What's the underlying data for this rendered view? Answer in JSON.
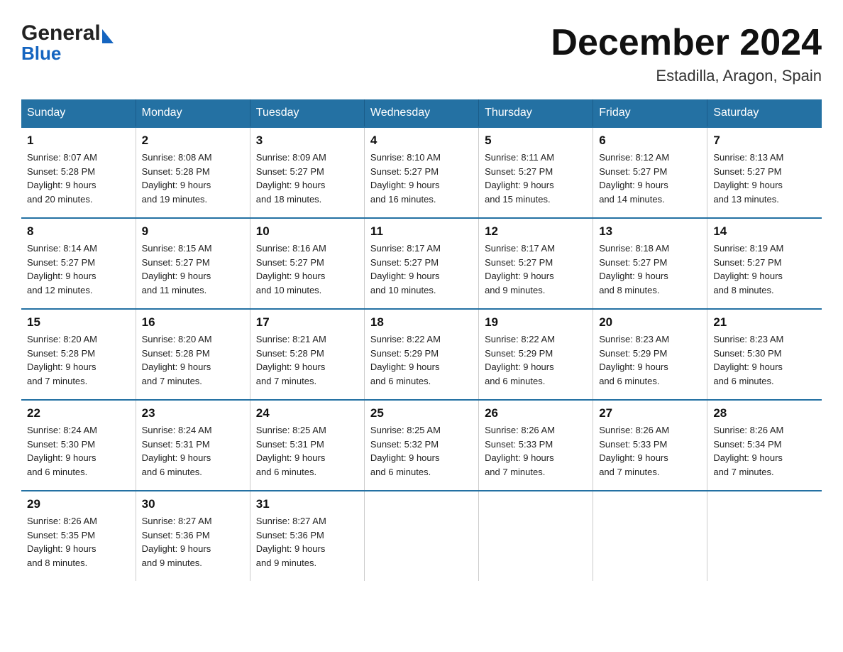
{
  "header": {
    "title": "December 2024",
    "subtitle": "Estadilla, Aragon, Spain",
    "logo_general": "General",
    "logo_blue": "Blue"
  },
  "columns": [
    "Sunday",
    "Monday",
    "Tuesday",
    "Wednesday",
    "Thursday",
    "Friday",
    "Saturday"
  ],
  "weeks": [
    [
      {
        "day": "1",
        "sunrise": "Sunrise: 8:07 AM",
        "sunset": "Sunset: 5:28 PM",
        "daylight": "Daylight: 9 hours",
        "daylight2": "and 20 minutes."
      },
      {
        "day": "2",
        "sunrise": "Sunrise: 8:08 AM",
        "sunset": "Sunset: 5:28 PM",
        "daylight": "Daylight: 9 hours",
        "daylight2": "and 19 minutes."
      },
      {
        "day": "3",
        "sunrise": "Sunrise: 8:09 AM",
        "sunset": "Sunset: 5:27 PM",
        "daylight": "Daylight: 9 hours",
        "daylight2": "and 18 minutes."
      },
      {
        "day": "4",
        "sunrise": "Sunrise: 8:10 AM",
        "sunset": "Sunset: 5:27 PM",
        "daylight": "Daylight: 9 hours",
        "daylight2": "and 16 minutes."
      },
      {
        "day": "5",
        "sunrise": "Sunrise: 8:11 AM",
        "sunset": "Sunset: 5:27 PM",
        "daylight": "Daylight: 9 hours",
        "daylight2": "and 15 minutes."
      },
      {
        "day": "6",
        "sunrise": "Sunrise: 8:12 AM",
        "sunset": "Sunset: 5:27 PM",
        "daylight": "Daylight: 9 hours",
        "daylight2": "and 14 minutes."
      },
      {
        "day": "7",
        "sunrise": "Sunrise: 8:13 AM",
        "sunset": "Sunset: 5:27 PM",
        "daylight": "Daylight: 9 hours",
        "daylight2": "and 13 minutes."
      }
    ],
    [
      {
        "day": "8",
        "sunrise": "Sunrise: 8:14 AM",
        "sunset": "Sunset: 5:27 PM",
        "daylight": "Daylight: 9 hours",
        "daylight2": "and 12 minutes."
      },
      {
        "day": "9",
        "sunrise": "Sunrise: 8:15 AM",
        "sunset": "Sunset: 5:27 PM",
        "daylight": "Daylight: 9 hours",
        "daylight2": "and 11 minutes."
      },
      {
        "day": "10",
        "sunrise": "Sunrise: 8:16 AM",
        "sunset": "Sunset: 5:27 PM",
        "daylight": "Daylight: 9 hours",
        "daylight2": "and 10 minutes."
      },
      {
        "day": "11",
        "sunrise": "Sunrise: 8:17 AM",
        "sunset": "Sunset: 5:27 PM",
        "daylight": "Daylight: 9 hours",
        "daylight2": "and 10 minutes."
      },
      {
        "day": "12",
        "sunrise": "Sunrise: 8:17 AM",
        "sunset": "Sunset: 5:27 PM",
        "daylight": "Daylight: 9 hours",
        "daylight2": "and 9 minutes."
      },
      {
        "day": "13",
        "sunrise": "Sunrise: 8:18 AM",
        "sunset": "Sunset: 5:27 PM",
        "daylight": "Daylight: 9 hours",
        "daylight2": "and 8 minutes."
      },
      {
        "day": "14",
        "sunrise": "Sunrise: 8:19 AM",
        "sunset": "Sunset: 5:27 PM",
        "daylight": "Daylight: 9 hours",
        "daylight2": "and 8 minutes."
      }
    ],
    [
      {
        "day": "15",
        "sunrise": "Sunrise: 8:20 AM",
        "sunset": "Sunset: 5:28 PM",
        "daylight": "Daylight: 9 hours",
        "daylight2": "and 7 minutes."
      },
      {
        "day": "16",
        "sunrise": "Sunrise: 8:20 AM",
        "sunset": "Sunset: 5:28 PM",
        "daylight": "Daylight: 9 hours",
        "daylight2": "and 7 minutes."
      },
      {
        "day": "17",
        "sunrise": "Sunrise: 8:21 AM",
        "sunset": "Sunset: 5:28 PM",
        "daylight": "Daylight: 9 hours",
        "daylight2": "and 7 minutes."
      },
      {
        "day": "18",
        "sunrise": "Sunrise: 8:22 AM",
        "sunset": "Sunset: 5:29 PM",
        "daylight": "Daylight: 9 hours",
        "daylight2": "and 6 minutes."
      },
      {
        "day": "19",
        "sunrise": "Sunrise: 8:22 AM",
        "sunset": "Sunset: 5:29 PM",
        "daylight": "Daylight: 9 hours",
        "daylight2": "and 6 minutes."
      },
      {
        "day": "20",
        "sunrise": "Sunrise: 8:23 AM",
        "sunset": "Sunset: 5:29 PM",
        "daylight": "Daylight: 9 hours",
        "daylight2": "and 6 minutes."
      },
      {
        "day": "21",
        "sunrise": "Sunrise: 8:23 AM",
        "sunset": "Sunset: 5:30 PM",
        "daylight": "Daylight: 9 hours",
        "daylight2": "and 6 minutes."
      }
    ],
    [
      {
        "day": "22",
        "sunrise": "Sunrise: 8:24 AM",
        "sunset": "Sunset: 5:30 PM",
        "daylight": "Daylight: 9 hours",
        "daylight2": "and 6 minutes."
      },
      {
        "day": "23",
        "sunrise": "Sunrise: 8:24 AM",
        "sunset": "Sunset: 5:31 PM",
        "daylight": "Daylight: 9 hours",
        "daylight2": "and 6 minutes."
      },
      {
        "day": "24",
        "sunrise": "Sunrise: 8:25 AM",
        "sunset": "Sunset: 5:31 PM",
        "daylight": "Daylight: 9 hours",
        "daylight2": "and 6 minutes."
      },
      {
        "day": "25",
        "sunrise": "Sunrise: 8:25 AM",
        "sunset": "Sunset: 5:32 PM",
        "daylight": "Daylight: 9 hours",
        "daylight2": "and 6 minutes."
      },
      {
        "day": "26",
        "sunrise": "Sunrise: 8:26 AM",
        "sunset": "Sunset: 5:33 PM",
        "daylight": "Daylight: 9 hours",
        "daylight2": "and 7 minutes."
      },
      {
        "day": "27",
        "sunrise": "Sunrise: 8:26 AM",
        "sunset": "Sunset: 5:33 PM",
        "daylight": "Daylight: 9 hours",
        "daylight2": "and 7 minutes."
      },
      {
        "day": "28",
        "sunrise": "Sunrise: 8:26 AM",
        "sunset": "Sunset: 5:34 PM",
        "daylight": "Daylight: 9 hours",
        "daylight2": "and 7 minutes."
      }
    ],
    [
      {
        "day": "29",
        "sunrise": "Sunrise: 8:26 AM",
        "sunset": "Sunset: 5:35 PM",
        "daylight": "Daylight: 9 hours",
        "daylight2": "and 8 minutes."
      },
      {
        "day": "30",
        "sunrise": "Sunrise: 8:27 AM",
        "sunset": "Sunset: 5:36 PM",
        "daylight": "Daylight: 9 hours",
        "daylight2": "and 9 minutes."
      },
      {
        "day": "31",
        "sunrise": "Sunrise: 8:27 AM",
        "sunset": "Sunset: 5:36 PM",
        "daylight": "Daylight: 9 hours",
        "daylight2": "and 9 minutes."
      },
      {
        "day": "",
        "sunrise": "",
        "sunset": "",
        "daylight": "",
        "daylight2": ""
      },
      {
        "day": "",
        "sunrise": "",
        "sunset": "",
        "daylight": "",
        "daylight2": ""
      },
      {
        "day": "",
        "sunrise": "",
        "sunset": "",
        "daylight": "",
        "daylight2": ""
      },
      {
        "day": "",
        "sunrise": "",
        "sunset": "",
        "daylight": "",
        "daylight2": ""
      }
    ]
  ]
}
